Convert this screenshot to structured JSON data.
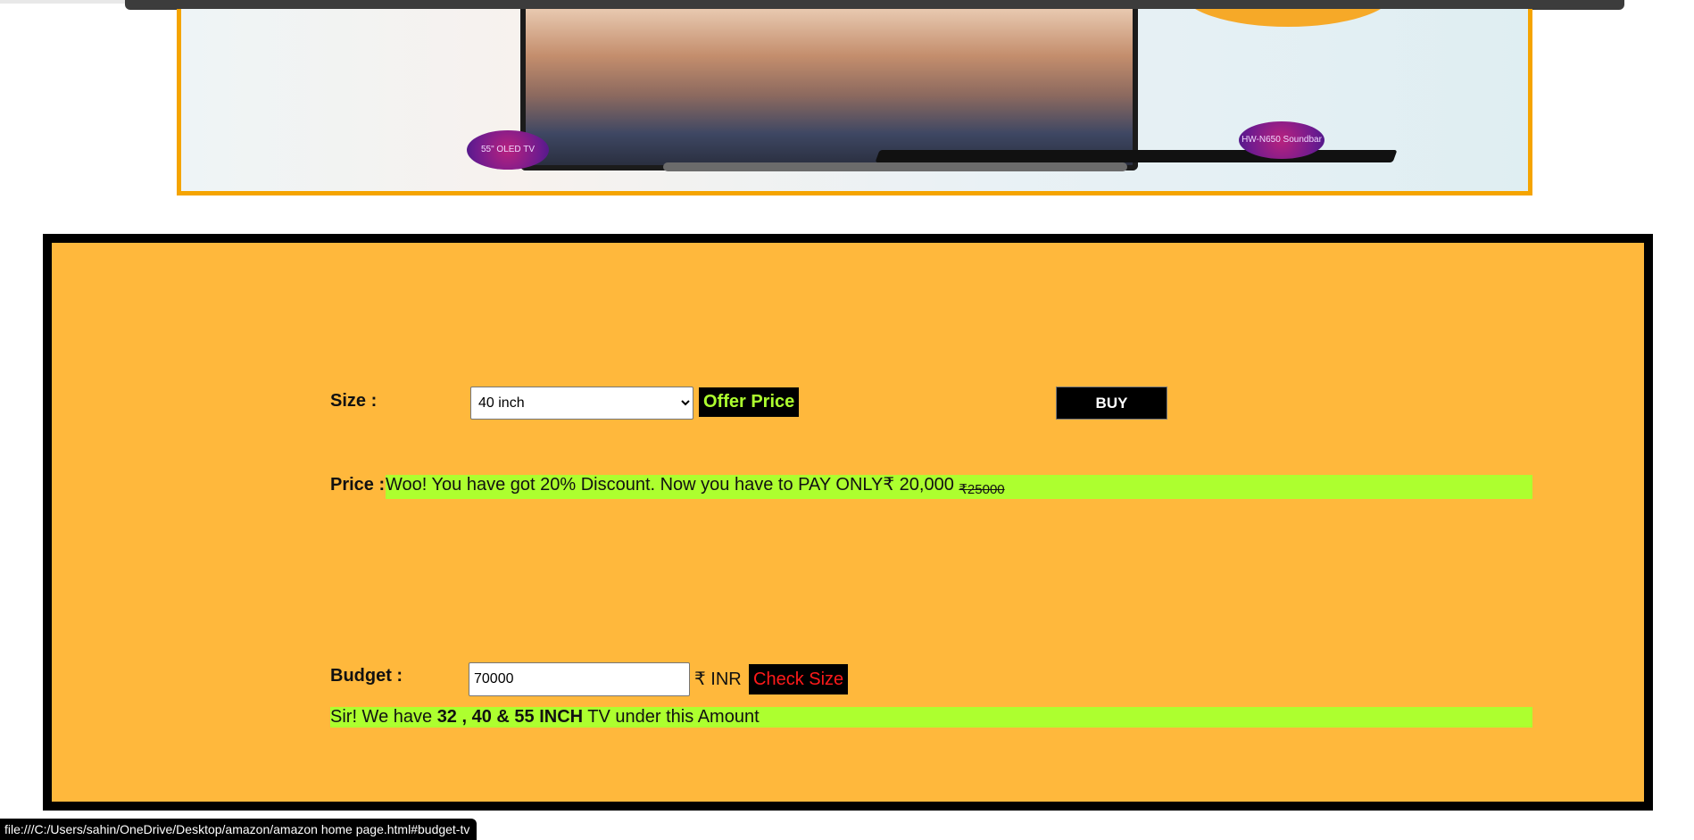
{
  "size_section": {
    "label": "Size :",
    "selected_option": "40 inch",
    "offer_button": "Offer Price",
    "buy_button": "BUY"
  },
  "price_section": {
    "label": "Price :",
    "message": "Woo! You have got 20% Discount. Now you have to PAY ONLY₹ 20,000 ",
    "original_price": "₹25000"
  },
  "budget_section": {
    "label": "Budget :",
    "input_value": "70000",
    "currency": "₹ INR",
    "check_button": "Check Size",
    "result_prefix": "Sir! We have ",
    "result_sizes": "32 , 40 & 55 INCH",
    "result_suffix": " TV under this Amount"
  },
  "banner": {
    "badge_left": "55\" OLED TV",
    "badge_right": "HW-N650 Soundbar"
  },
  "status_url": "file:///C:/Users/sahin/OneDrive/Desktop/amazon/amazon home page.html#budget-tv",
  "colors": {
    "panel_bg": "#ffb83c",
    "highlight": "#adff2f",
    "banner_border": "#f5a400"
  }
}
